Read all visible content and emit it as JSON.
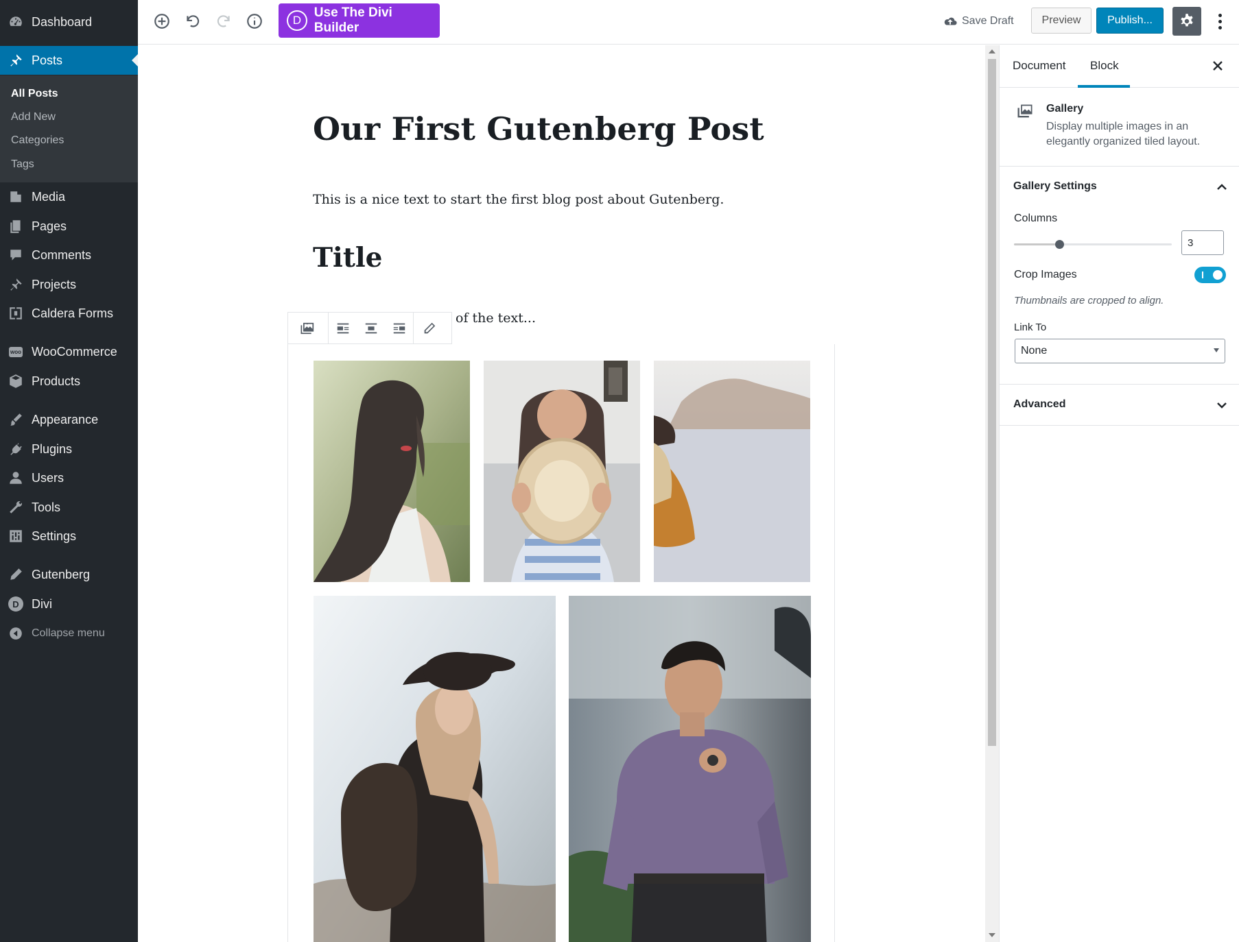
{
  "admin_menu": {
    "dashboard": "Dashboard",
    "posts": "Posts",
    "posts_sub": [
      "All Posts",
      "Add New",
      "Categories",
      "Tags"
    ],
    "media": "Media",
    "pages": "Pages",
    "comments": "Comments",
    "projects": "Projects",
    "caldera": "Caldera Forms",
    "woocommerce": "WooCommerce",
    "products": "Products",
    "appearance": "Appearance",
    "plugins": "Plugins",
    "users": "Users",
    "tools": "Tools",
    "settings": "Settings",
    "gutenberg": "Gutenberg",
    "divi": "Divi",
    "collapse": "Collapse menu",
    "woo_badge": "woo",
    "divi_letter": "D"
  },
  "toolbar": {
    "divi_button": "Use The Divi Builder",
    "divi_letter": "D",
    "save_draft": "Save Draft",
    "preview": "Preview",
    "publish": "Publish..."
  },
  "post": {
    "title": "Our First Gutenberg Post",
    "paragraph_1": "This is a nice text to start the first blog post about Gutenberg.",
    "heading": "Title",
    "paragraph_2": "of the text..."
  },
  "sidebar": {
    "tabs": {
      "document": "Document",
      "block": "Block"
    },
    "block_card": {
      "title": "Gallery",
      "description": "Display multiple images in an elegantly organized tiled layout."
    },
    "gallery_settings": {
      "header": "Gallery Settings",
      "columns_label": "Columns",
      "columns_value": "3",
      "columns_slider": {
        "value": 3,
        "min": 1,
        "max": 8
      },
      "crop_label": "Crop Images",
      "crop_enabled": true,
      "crop_help": "Thumbnails are cropped to align.",
      "link_to_label": "Link To",
      "link_to_value": "None"
    },
    "advanced": "Advanced"
  },
  "colors": {
    "admin_bg": "#23282d",
    "admin_active": "#0073aa",
    "divi_purple": "#8c32e0",
    "publish_blue": "#0085ba",
    "toggle_blue": "#11a0d2"
  },
  "icons": {
    "toolbar": [
      "add-block-icon",
      "undo-icon",
      "redo-icon",
      "info-icon",
      "cloud-upload-icon",
      "gear-icon",
      "more-vertical-icon"
    ],
    "block_toolbar": [
      "gallery-icon",
      "align-left-icon",
      "align-center-icon",
      "align-right-icon",
      "edit-pencil-icon"
    ]
  }
}
